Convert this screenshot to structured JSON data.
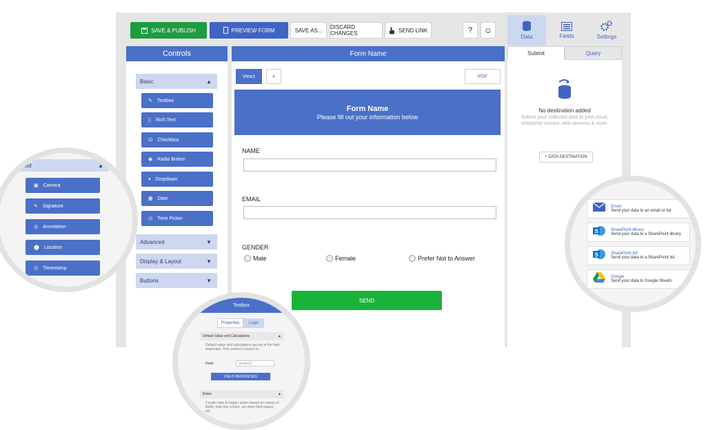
{
  "toolbar": {
    "save_publish": "SAVE & PUBLISH",
    "preview_form": "PREVIEW FORM",
    "save_as": "SAVE AS...",
    "discard_changes": "DISCARD CHANGES",
    "send_link": "SEND LINK",
    "help": "?",
    "feedback": "☺"
  },
  "right_tabs": [
    {
      "label": "Data",
      "icon": "database-icon"
    },
    {
      "label": "Fields",
      "icon": "fields-icon"
    },
    {
      "label": "Settings",
      "icon": "gears-icon"
    }
  ],
  "controls": {
    "title": "Controls",
    "basic": "Basic",
    "basic_items": [
      "Textbox",
      "Rich Text",
      "Checkbox",
      "Radio Button",
      "Dropdown",
      "Date",
      "Time Picker"
    ],
    "advanced": "Advanced",
    "display_layout": "Display & Layout",
    "buttons": "Buttons"
  },
  "form": {
    "header": "Form Name",
    "view_tab": "View1",
    "add_view": "+",
    "pdf": "PDF",
    "banner_title": "Form Name",
    "banner_subtitle": "Please fill out your information below",
    "name_label": "NAME",
    "email_label": "EMAIL",
    "gender_label": "GENDER",
    "gender_options": [
      "Male",
      "Female",
      "Prefer Not to Answer"
    ],
    "send": "SEND"
  },
  "data_panel": {
    "submit_tab": "Submit",
    "query_tab": "Query",
    "no_dest_title": "No destination added",
    "no_dest_text": "Submit your collected data to your cloud, enterprise service, web services & more.",
    "add_dest": "+ DATA DESTINATION"
  },
  "advanced_zoom": {
    "header": "Advanced",
    "items": [
      "Camera",
      "Signature",
      "Annotation",
      "Location",
      "Timestamp"
    ]
  },
  "textbox_zoom": {
    "title": "Textbox",
    "tab_properties": "Properties",
    "tab_logic": "Logic",
    "section_default": "Default Value and Calculations",
    "default_text": "Default value and calculations are set in the field properties. This control is bound to:",
    "field_label": "Field:",
    "field_value": "textbox1",
    "field_properties": "FIELD PROPERTIES",
    "section_rules": "Rules",
    "rules_text": "Create rules to trigger action based on values of fields: hide this control, set other field values, etc."
  },
  "destinations_zoom": [
    {
      "name": "Email",
      "desc": "Send your data to an email or list",
      "icon": "email-icon",
      "color": "#3f64c3"
    },
    {
      "name": "SharePoint library",
      "desc": "Send your data to a SharePoint library",
      "icon": "sharepoint-icon",
      "color": "#0a73c7"
    },
    {
      "name": "SharePoint list",
      "desc": "Send your data to a SharePoint list",
      "icon": "sharepoint-icon",
      "color": "#0a73c7"
    },
    {
      "name": "Google",
      "desc": "Send your data to Google Sheets",
      "icon": "google-drive-icon",
      "color": "#fbbc04"
    }
  ]
}
